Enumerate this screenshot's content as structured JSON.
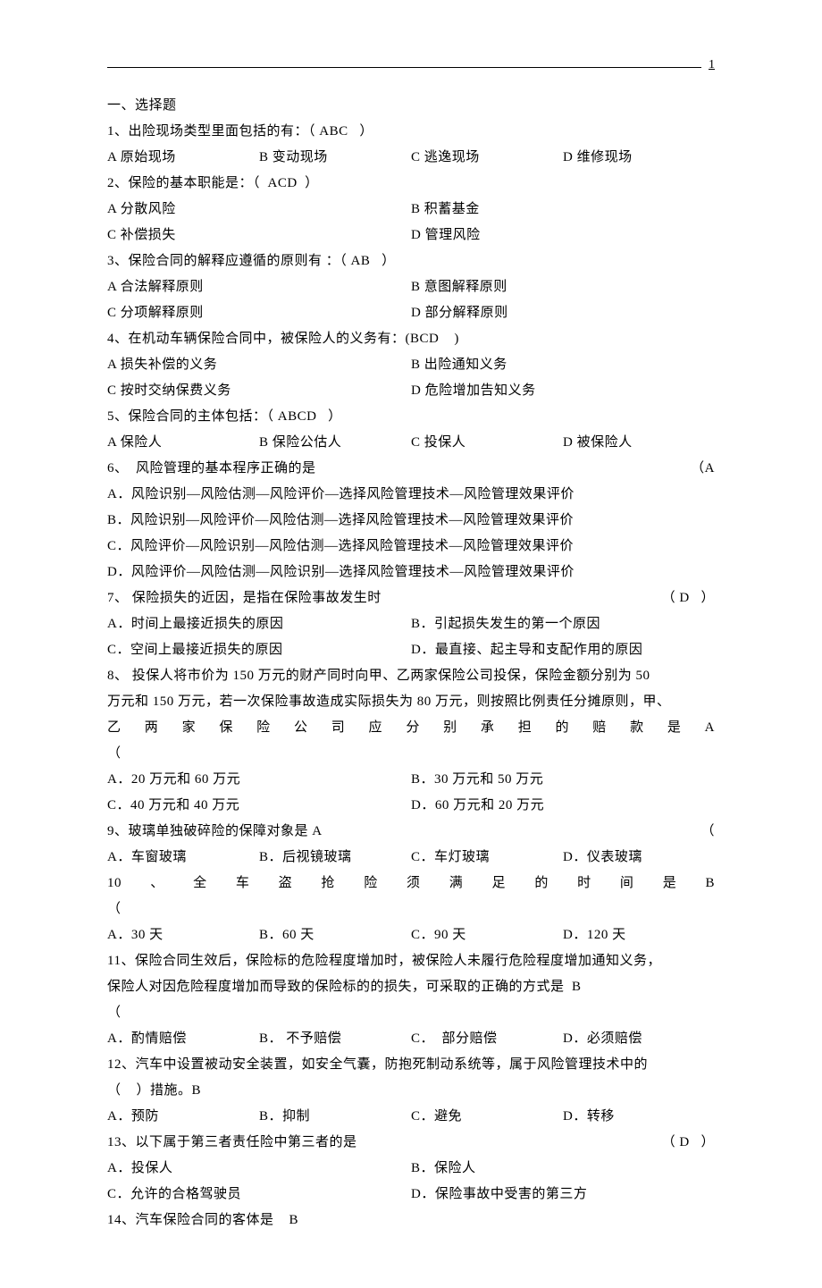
{
  "pageNumber": "1",
  "sectionTitle": "一、选择题",
  "q1": {
    "stem": "1、出险现场类型里面包括的有：（ ABC   ）",
    "a": "A 原始现场",
    "b": "B 变动现场",
    "c": "C 逃逸现场",
    "d": "D 维修现场"
  },
  "q2": {
    "stem": "2、保险的基本职能是：（  ACD  ）",
    "a": "A 分散风险",
    "b": "B 积蓄基金",
    "c": "C 补偿损失",
    "d": "D 管理风险"
  },
  "q3": {
    "stem": "3、保险合同的解释应遵循的原则有 ：（ AB   ）",
    "a": "A 合法解释原则",
    "b": "B 意图解释原则",
    "c": "C 分项解释原则",
    "d": "D 部分解释原则"
  },
  "q4": {
    "stem": "4、在机动车辆保险合同中，被保险人的义务有：(BCD    )",
    "a": "A 损失补偿的义务",
    "b": "B 出险通知义务",
    "c": "C 按时交纳保费义务",
    "d": "D 危险增加告知义务"
  },
  "q5": {
    "stem": "5、保险合同的主体包括：（ ABCD   ）",
    "a": "A 保险人",
    "b": "B 保险公估人",
    "c": "C 投保人",
    "d": "D 被保险人"
  },
  "q6": {
    "stem": "6、  风险管理的基本程序正确的是",
    "ans": "（A",
    "a": "A．风险识别—风险估测—风险评价—选择风险管理技术—风险管理效果评价",
    "b": "B．风险识别—风险评价—风险估测—选择风险管理技术—风险管理效果评价",
    "c": "C．风险评价—风险识别—风险估测—选择风险管理技术—风险管理效果评价",
    "d": "D．风险评价—风险估测—风险识别—选择风险管理技术—风险管理效果评价"
  },
  "q7": {
    "stem": "7、 保险损失的近因，是指在保险事故发生时",
    "ans": "（ D   ）",
    "a": "A．时间上最接近损失的原因",
    "b": "B．引起损失发生的第一个原因",
    "c": "C．空间上最接近损失的原因",
    "d": "D．最直接、起主导和支配作用的原因"
  },
  "q8": {
    "l1": "8、 投保人将市价为 150 万元的财产同时向甲、乙两家保险公司投保，保险金额分别为 50",
    "l2": "万元和 150 万元，若一次保险事故造成实际损失为 80 万元，则按照比例责任分摊原则，甲、",
    "l3": "乙两家保险公司应分别承担的赔款是A",
    "l4": "（",
    "a": "A．20 万元和 60 万元",
    "b": "B．30 万元和 50 万元",
    "c": "C．40 万元和 40 万元",
    "d": "D．60 万元和 20 万元"
  },
  "q9": {
    "stem": "9、玻璃单独破碎险的保障对象是 A",
    "ans": "（",
    "a": "A．车窗玻璃",
    "b": "B．后视镜玻璃",
    "c": "C．车灯玻璃",
    "d": "D．仪表玻璃"
  },
  "q10": {
    "stem": "10、全车盗抢险须满足的时间是B",
    "stem2": "（",
    "a": "A．30 天",
    "b": "B．60 天",
    "c": "C．90 天",
    "d": "D．120 天"
  },
  "q11": {
    "l1": "11、保险合同生效后，保险标的危险程度增加时，被保险人未履行危险程度增加通知义务，",
    "l2": "保险人对因危险程度增加而导致的保险标的的损失，可采取的正确的方式是  B",
    "l3": "（",
    "a": "A．酌情赔偿",
    "b": "B． 不予赔偿",
    "c": "C．  部分赔偿",
    "d": "D．必须赔偿"
  },
  "q12": {
    "l1": "12、汽车中设置被动安全装置，如安全气囊，防抱死制动系统等，属于风险管理技术中的",
    "l2": "（    ）措施。B",
    "a": "A．预防",
    "b": "B．抑制",
    "c": "C．避免",
    "d": "D．转移"
  },
  "q13": {
    "stem": "13、以下属于第三者责任险中第三者的是",
    "ans": "（ D   ）",
    "a": "A．投保人",
    "b": "B．保险人",
    "c": "C．允许的合格驾驶员",
    "d": "D．保险事故中受害的第三方"
  },
  "q14": {
    "stem": "14、汽车保险合同的客体是    B"
  }
}
